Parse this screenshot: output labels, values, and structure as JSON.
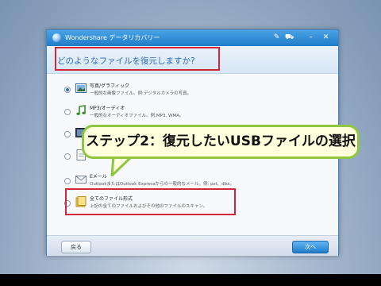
{
  "window": {
    "app_title": "Wondershare データリカバリー",
    "titlebar_icons": [
      "register-icon",
      "cart-icon",
      "minimize-icon",
      "close-icon"
    ]
  },
  "header": {
    "question": "どのようなファイルを復元しますか?"
  },
  "options": [
    {
      "title": "写真/グラフィック",
      "desc": "一般的な画像ファイル。例:デジタルカメラの写真。",
      "icon": "photo-icon",
      "selected": true
    },
    {
      "title": "MP3/オーディオ",
      "desc": "一般的なオーディオファイル。例:MP3, WMA。",
      "icon": "music-note-icon",
      "selected": false
    },
    {
      "title": "",
      "desc": "",
      "icon": "video-icon",
      "selected": false
    },
    {
      "title": "",
      "desc": "",
      "icon": "document-icon",
      "selected": false
    },
    {
      "title": "Eメール",
      "desc": "OutlookまたはOutlook Expressからの一般的なメール。例: pst、dbx。",
      "icon": "email-icon",
      "selected": false
    },
    {
      "title": "全てのファイル形式",
      "desc": "上記の全てのファイルおよびその他のファイルのスキャン。",
      "icon": "all-files-icon",
      "selected": false
    }
  ],
  "footer": {
    "back_label": "戻る",
    "next_label": "次へ"
  },
  "callout": {
    "text": "ステップ2：復元したいUSBファイルの選択"
  },
  "colors": {
    "accent": "#1f7cc9",
    "highlight_red": "#d0283a",
    "callout_border": "#8ec63f",
    "callout_fill": "#ffffdd"
  }
}
